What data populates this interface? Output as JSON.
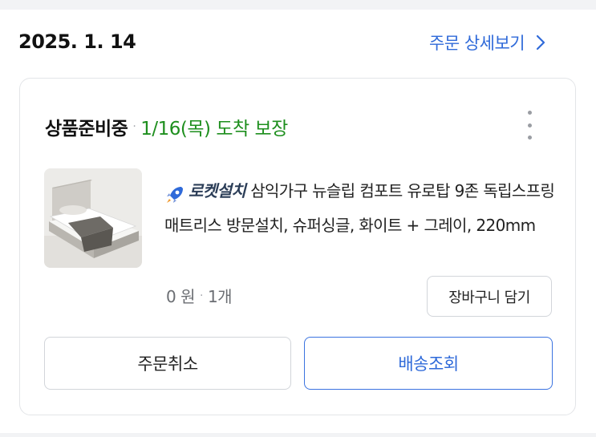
{
  "order": {
    "date": "2025. 1. 14",
    "detail_link": "주문 상세보기"
  },
  "card": {
    "status": "상품준비중",
    "separator": "·",
    "arrival": "1/16(목) 도착 보장",
    "product": {
      "badge": "로켓설치",
      "name": "삼익가구 뉴슬립 컴포트 유로탑 9존 독립스프링 매트리스 방문설치, 슈퍼싱글, 화이트 + 그레이, 220mm",
      "price": "0 원",
      "quantity": "1개"
    },
    "add_to_cart": "장바구니 담기",
    "cancel_order": "주문취소",
    "track_delivery": "배송조회"
  },
  "colors": {
    "link_blue": "#2f6ad9",
    "arrival_green": "#1e8f1e",
    "border": "#e3e5e8"
  },
  "icons": [
    "chevron-right-icon",
    "more-vertical-icon",
    "rocket-icon"
  ]
}
